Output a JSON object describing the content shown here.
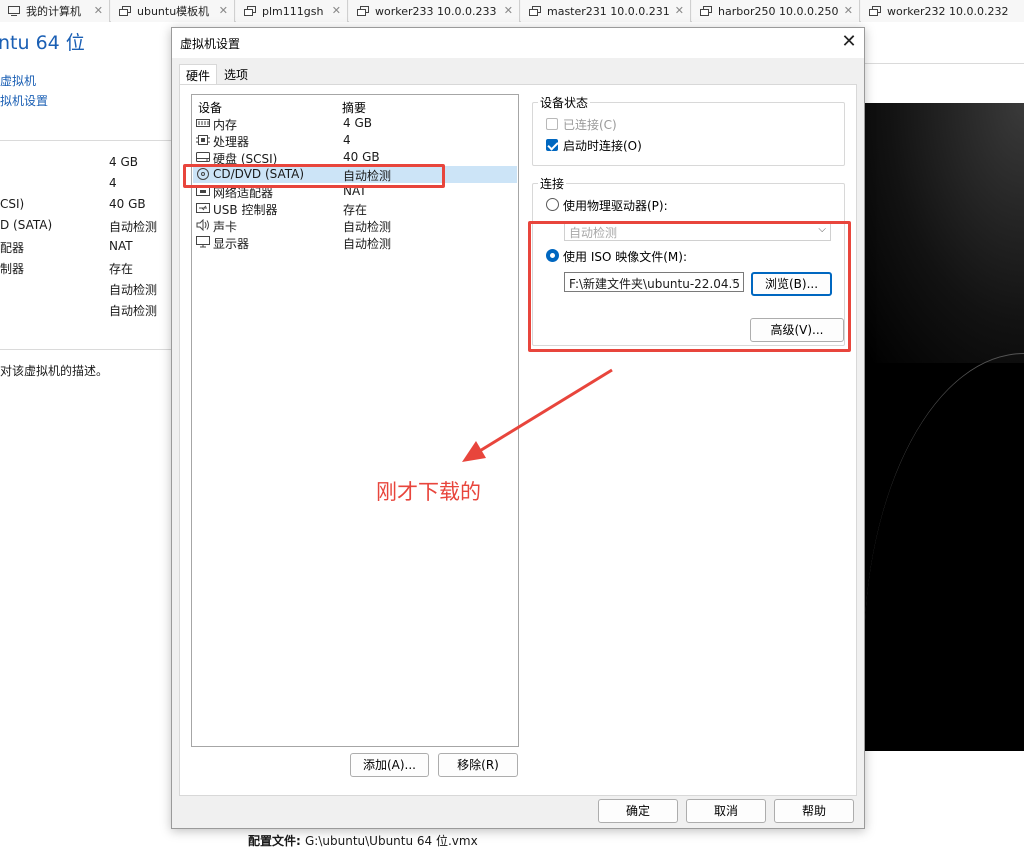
{
  "tabs": [
    {
      "label": "我的计算机",
      "icon": "computer-icon"
    },
    {
      "label": "ubuntu模板机",
      "icon": "vm-icon"
    },
    {
      "label": "plm111gsh",
      "icon": "vm-icon"
    },
    {
      "label": "worker233 10.0.0.233",
      "icon": "vm-icon"
    },
    {
      "label": "master231 10.0.0.231",
      "icon": "vm-icon"
    },
    {
      "label": "harbor250 10.0.0.250",
      "icon": "vm-icon"
    },
    {
      "label": "worker232 10.0.0.232",
      "icon": "vm-icon"
    }
  ],
  "background": {
    "vm_title": "ntu 64 位",
    "links": [
      "虚拟机",
      "拟机设置"
    ],
    "device_rows": [
      {
        "name": "",
        "value": "4 GB"
      },
      {
        "name": "",
        "value": "4"
      },
      {
        "name": "CSI)",
        "value": "40 GB"
      },
      {
        "name": "D (SATA)",
        "value": "自动检测"
      },
      {
        "name": "配器",
        "value": "NAT"
      },
      {
        "name": "制器",
        "value": "存在"
      },
      {
        "name": "",
        "value": "自动检测"
      },
      {
        "name": "",
        "value": "自动检测"
      }
    ],
    "description": "对该虚拟机的描述。",
    "config_label": "配置文件:",
    "config_value": "G:\\ubuntu\\Ubuntu 64 位.vmx"
  },
  "dialog": {
    "title": "虚拟机设置",
    "close_glyph": "✕",
    "tabs": [
      "硬件",
      "选项"
    ],
    "columns": {
      "device": "设备",
      "summary": "摘要"
    },
    "devices": [
      {
        "name": "内存",
        "summary": "4 GB",
        "icon": "memory-icon"
      },
      {
        "name": "处理器",
        "summary": "4",
        "icon": "cpu-icon"
      },
      {
        "name": "硬盘 (SCSI)",
        "summary": "40 GB",
        "icon": "harddisk-icon"
      },
      {
        "name": "CD/DVD (SATA)",
        "summary": "自动检测",
        "icon": "cd-dvd-icon"
      },
      {
        "name": "网络适配器",
        "summary": "NAT",
        "icon": "network-adapter-icon"
      },
      {
        "name": "USB 控制器",
        "summary": "存在",
        "icon": "usb-icon"
      },
      {
        "name": "声卡",
        "summary": "自动检测",
        "icon": "sound-card-icon"
      },
      {
        "name": "显示器",
        "summary": "自动检测",
        "icon": "display-icon"
      }
    ],
    "selected_device": "CD/DVD (SATA)",
    "add_button": "添加(A)...",
    "remove_button": "移除(R)",
    "device_status": {
      "title": "设备状态",
      "connected_label": "已连接(C)",
      "connected": false,
      "connect_at_power_on_label": "启动时连接(O)",
      "connect_at_power_on": true
    },
    "connection": {
      "title": "连接",
      "physical_drive_label": "使用物理驱动器(P):",
      "physical_drive_value": "自动检测",
      "iso_label": "使用 ISO 映像文件(M):",
      "iso_path": "F:\\新建文件夹\\ubuntu-22.04.5",
      "browse_button": "浏览(B)...",
      "selected": "iso"
    },
    "advanced_button": "高级(V)...",
    "ok_button": "确定",
    "cancel_button": "取消",
    "help_button": "帮助"
  },
  "annotation": {
    "text": "刚才下载的",
    "color": "#e8453c"
  }
}
